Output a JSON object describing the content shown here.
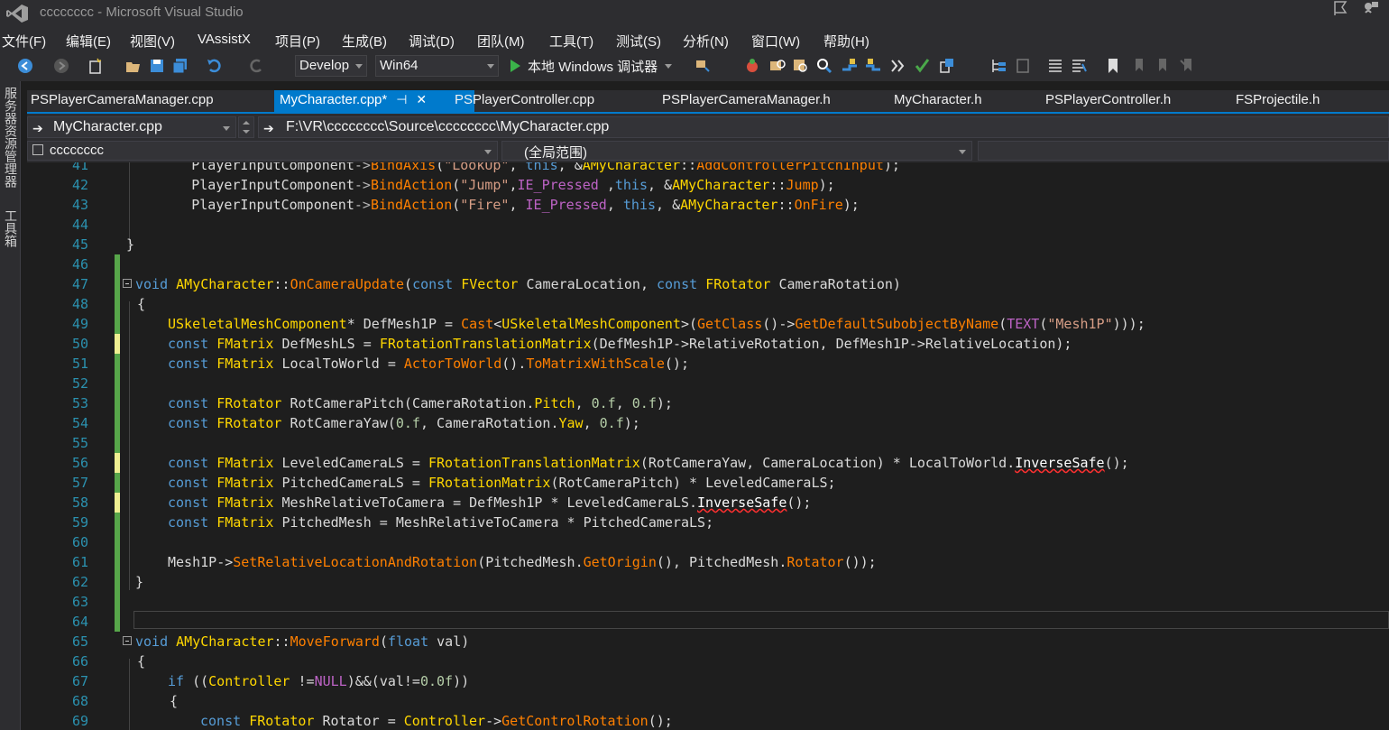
{
  "window": {
    "title": "cccccccc - Microsoft Visual Studio"
  },
  "menu": [
    "文件(F)",
    "编辑(E)",
    "视图(V)",
    "VAssistX",
    "项目(P)",
    "生成(B)",
    "调试(D)",
    "团队(M)",
    "工具(T)",
    "测试(S)",
    "分析(N)",
    "窗口(W)",
    "帮助(H)"
  ],
  "toolbar": {
    "config": "Develop",
    "platform": "Win64",
    "debugger": "本地 Windows 调试器",
    "icons": [
      "back-icon",
      "forward-icon",
      "new-project-icon",
      "open-icon",
      "save-icon",
      "save-all-icon",
      "undo-icon",
      "redo-icon"
    ]
  },
  "tabs": [
    {
      "label": "PSPlayerCameraManager.cpp",
      "active": false
    },
    {
      "label": "MyCharacter.cpp*",
      "active": true
    },
    {
      "label": "PSPlayerController.cpp",
      "active": false
    },
    {
      "label": "PSPlayerCameraManager.h",
      "active": false
    },
    {
      "label": "MyCharacter.h",
      "active": false
    },
    {
      "label": "PSPlayerController.h",
      "active": false
    },
    {
      "label": "FSProjectile.h",
      "active": false
    }
  ],
  "nav": {
    "file": "MyCharacter.cpp",
    "path": "F:\\VR\\cccccccc\\Source\\cccccccc\\MyCharacter.cpp",
    "project": "cccccccc",
    "scope": "(全局范围)"
  },
  "sidebar": {
    "server_explorer": "服务器资源管理器",
    "toolbox": "工具箱"
  },
  "editor": {
    "line_numbers": [
      "41",
      "42",
      "43",
      "44",
      "45",
      "46",
      "47",
      "48",
      "49",
      "50",
      "51",
      "52",
      "53",
      "54",
      "55",
      "56",
      "57",
      "58",
      "59",
      "60",
      "61",
      "62",
      "63",
      "64",
      "65",
      "66",
      "67",
      "68",
      "69"
    ],
    "colors": {
      "keyword": "#569cd6",
      "type": "#ffd700",
      "function": "#ff8000",
      "string": "#d69d85",
      "macro": "#bd63c5",
      "saved_change": "#57a64a",
      "unsaved_change": "#efef91"
    }
  }
}
